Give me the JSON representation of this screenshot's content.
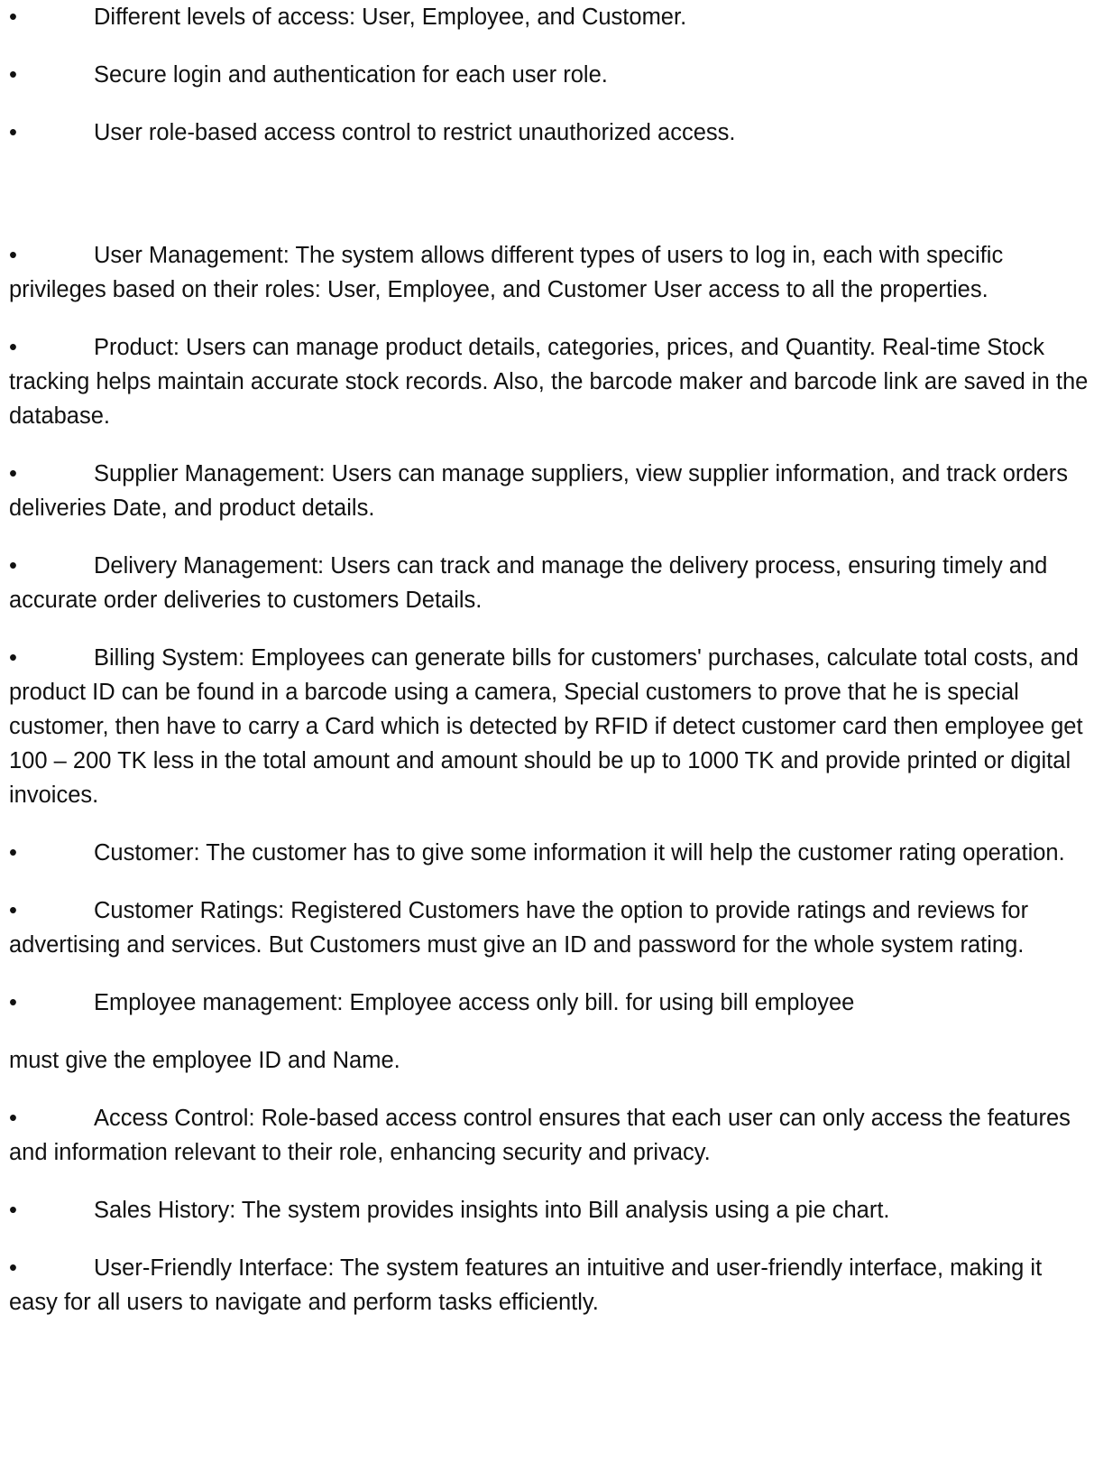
{
  "document": {
    "intro_bullets": [
      "Different levels of access: User, Employee, and Customer.",
      "Secure login and authentication for each user role.",
      "User role-based access control to restrict unauthorized access."
    ],
    "feature_bullets": [
      "User Management: The system allows different types of users to log in, each with specific privileges based on their roles: User, Employee, and Customer User access to all the properties.",
      "Product: Users can manage product details, categories, prices, and Quantity. Real-time Stock tracking helps maintain accurate stock records. Also, the barcode maker and barcode link are saved in the database.",
      "Supplier Management: Users can manage suppliers, view supplier information, and track orders deliveries Date, and product details.",
      "Delivery Management: Users can track and manage the delivery process, ensuring timely and accurate order deliveries to customers Details.",
      "Billing System: Employees can generate bills for customers' purchases, calculate total costs, and product ID can be found in a barcode using a camera, Special customers to prove that he is special customer, then have to carry a Card which is detected by RFID if detect customer card then employee get 100 – 200 TK less in the total amount and amount should be up to 1000 TK and provide printed or digital invoices.",
      "Customer: The customer has to give some information it will help the customer rating operation.",
      "Customer Ratings: Registered Customers have the option to provide ratings and reviews for advertising and services. But Customers must give an ID and password for the whole system rating.",
      "Employee management: Employee access only bill. for using bill employee"
    ],
    "continuation": "must give the employee ID and Name.",
    "final_bullets": [
      "Access Control: Role-based access control ensures that each user can only access the features and information relevant to their role, enhancing security and privacy.",
      "Sales History: The system provides insights into Bill analysis using a pie chart.",
      "User-Friendly Interface: The system features an intuitive and user-friendly interface, making it easy for all users to navigate and perform tasks efficiently."
    ],
    "bullet_glyph": "•"
  }
}
